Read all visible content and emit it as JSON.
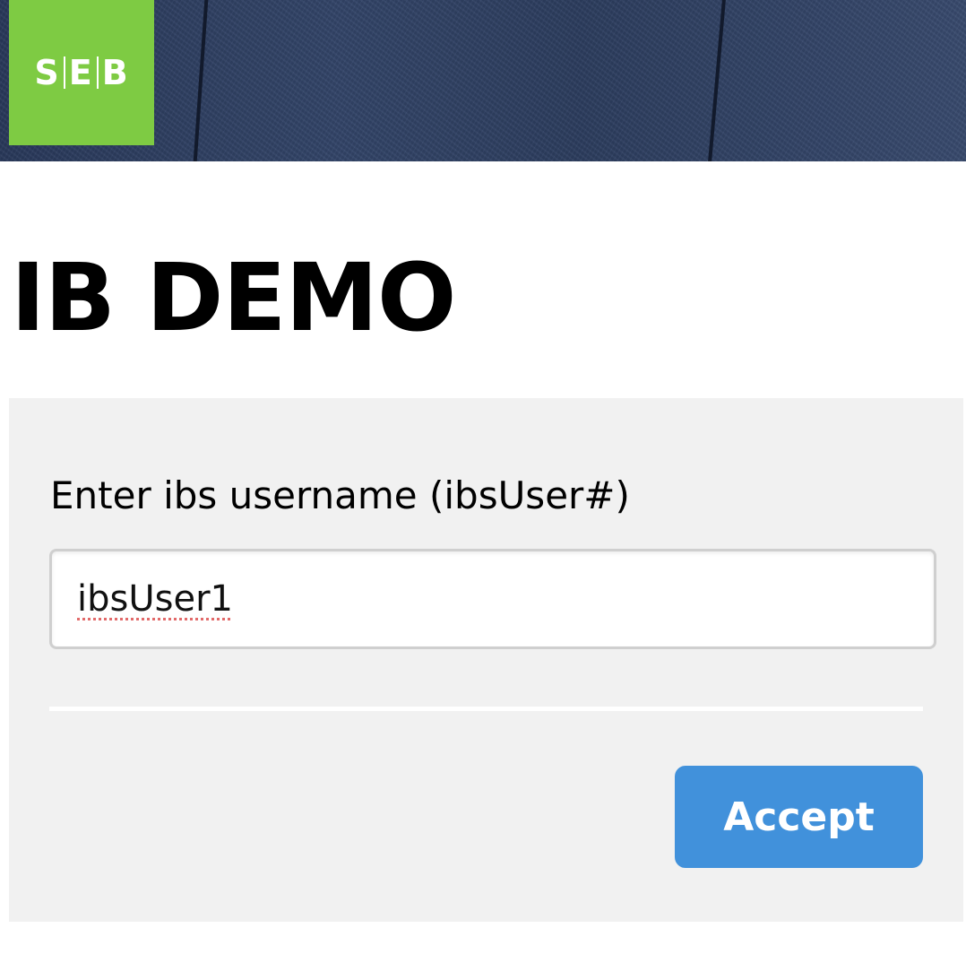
{
  "header": {
    "logo": {
      "text_left": "S",
      "text_mid": "E",
      "text_right": "B",
      "background": "#7ecb43"
    }
  },
  "page": {
    "title": "IB DEMO"
  },
  "form": {
    "label": "Enter ibs username (ibsUser#)",
    "username_value": "ibsUser1",
    "spellcheck_flag": "misspelled-underline",
    "accept_label": "Accept",
    "accept_color": "#4191db",
    "panel_color": "#f1f1f1"
  }
}
